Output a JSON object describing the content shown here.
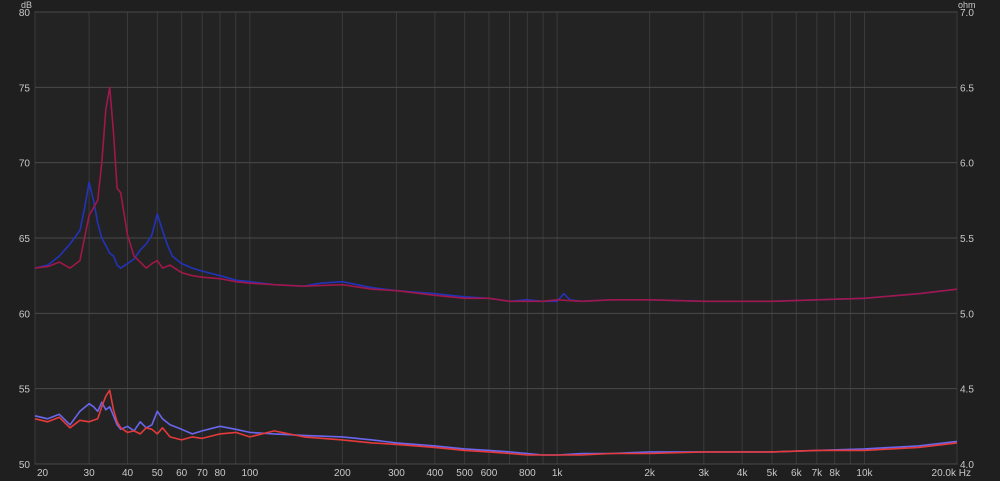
{
  "chart_data": {
    "type": "line",
    "x_scale": "log",
    "x_unit": "Hz",
    "y_left_unit": "dB",
    "y_right_unit": "ohm",
    "xlim": [
      20,
      20000
    ],
    "ylim_left": [
      50,
      80
    ],
    "ylim_right": [
      4.0,
      7.0
    ],
    "grid": true,
    "x_ticks": [
      {
        "v": 20,
        "label": "20"
      },
      {
        "v": 30,
        "label": "30"
      },
      {
        "v": 40,
        "label": "40"
      },
      {
        "v": 50,
        "label": "50"
      },
      {
        "v": 60,
        "label": "60"
      },
      {
        "v": 70,
        "label": "70"
      },
      {
        "v": 80,
        "label": "80"
      },
      {
        "v": 100,
        "label": "100"
      },
      {
        "v": 200,
        "label": "200"
      },
      {
        "v": 300,
        "label": "300"
      },
      {
        "v": 400,
        "label": "400"
      },
      {
        "v": 500,
        "label": "500"
      },
      {
        "v": 600,
        "label": "600"
      },
      {
        "v": 800,
        "label": "800"
      },
      {
        "v": 1000,
        "label": "1k"
      },
      {
        "v": 2000,
        "label": "2k"
      },
      {
        "v": 3000,
        "label": "3k"
      },
      {
        "v": 4000,
        "label": "4k"
      },
      {
        "v": 5000,
        "label": "5k"
      },
      {
        "v": 6000,
        "label": "6k"
      },
      {
        "v": 7000,
        "label": "7k"
      },
      {
        "v": 8000,
        "label": "8k"
      },
      {
        "v": 10000,
        "label": "10k"
      },
      {
        "v": 20000,
        "label": "20.0k Hz"
      }
    ],
    "y_left_ticks": [
      "80",
      "75",
      "70",
      "65",
      "60",
      "55",
      "50"
    ],
    "y_right_ticks": [
      "7.0",
      "6.5",
      "6.0",
      "5.5",
      "5.0",
      "4.5",
      "4.0"
    ],
    "series": [
      {
        "color": "#2233bb",
        "axis": "left",
        "x": [
          20,
          22,
          24,
          26,
          28,
          29,
          30,
          31,
          32,
          33,
          34,
          35,
          36,
          37,
          38,
          40,
          42,
          44,
          46,
          48,
          50,
          52,
          54,
          56,
          60,
          65,
          70,
          80,
          90,
          100,
          120,
          150,
          170,
          200,
          250,
          300,
          400,
          500,
          600,
          700,
          800,
          900,
          1000,
          1050,
          1100,
          1200,
          1500,
          2000,
          3000,
          5000,
          7000,
          10000,
          15000,
          20000
        ],
        "y": [
          63.0,
          63.2,
          63.8,
          64.6,
          65.5,
          67.0,
          68.7,
          67.5,
          66.0,
          65.0,
          64.5,
          64.0,
          63.8,
          63.2,
          63.0,
          63.3,
          63.6,
          64.2,
          64.6,
          65.2,
          66.6,
          65.5,
          64.5,
          63.8,
          63.3,
          63.0,
          62.8,
          62.5,
          62.2,
          62.1,
          61.9,
          61.8,
          62.0,
          62.1,
          61.7,
          61.5,
          61.3,
          61.1,
          61.0,
          60.8,
          60.9,
          60.8,
          60.8,
          61.3,
          60.9,
          60.8,
          60.9,
          60.9,
          60.8,
          60.8,
          60.9,
          61.0,
          61.3,
          61.6
        ]
      },
      {
        "color": "#a0184a",
        "axis": "left",
        "x": [
          20,
          22,
          24,
          26,
          28,
          30,
          32,
          33,
          34,
          35,
          36,
          37,
          38,
          40,
          42,
          44,
          46,
          48,
          50,
          52,
          55,
          60,
          65,
          70,
          80,
          90,
          100,
          120,
          150,
          200,
          250,
          300,
          400,
          500,
          600,
          700,
          800,
          900,
          1000,
          1200,
          1500,
          2000,
          3000,
          5000,
          7000,
          10000,
          15000,
          20000
        ],
        "y": [
          63.0,
          63.1,
          63.4,
          63.0,
          63.5,
          66.5,
          67.5,
          70.0,
          73.5,
          75.0,
          72.0,
          68.3,
          68.0,
          65.2,
          63.8,
          63.4,
          63.0,
          63.3,
          63.5,
          63.0,
          63.2,
          62.7,
          62.5,
          62.4,
          62.3,
          62.1,
          62.0,
          61.9,
          61.8,
          61.9,
          61.6,
          61.5,
          61.2,
          61.0,
          61.0,
          60.8,
          60.8,
          60.8,
          60.9,
          60.8,
          60.9,
          60.9,
          60.8,
          60.8,
          60.9,
          61.0,
          61.3,
          61.6
        ]
      },
      {
        "color": "#6a66ee",
        "axis": "left",
        "x": [
          20,
          22,
          24,
          26,
          28,
          30,
          31,
          32,
          33,
          34,
          35,
          36,
          37,
          38,
          40,
          42,
          44,
          46,
          48,
          50,
          52,
          55,
          60,
          65,
          70,
          80,
          90,
          100,
          120,
          150,
          200,
          250,
          300,
          400,
          500,
          600,
          700,
          800,
          900,
          1000,
          1200,
          1500,
          2000,
          3000,
          5000,
          7000,
          10000,
          15000,
          20000
        ],
        "y": [
          53.2,
          53.0,
          53.3,
          52.6,
          53.5,
          54.0,
          53.8,
          53.5,
          54.1,
          53.6,
          53.8,
          53.2,
          52.6,
          52.3,
          52.5,
          52.2,
          52.8,
          52.4,
          52.6,
          53.5,
          53.0,
          52.6,
          52.3,
          52.0,
          52.2,
          52.5,
          52.3,
          52.1,
          52.0,
          51.9,
          51.8,
          51.6,
          51.4,
          51.2,
          51.0,
          50.9,
          50.8,
          50.7,
          50.6,
          50.6,
          50.7,
          50.7,
          50.8,
          50.8,
          50.8,
          50.9,
          51.0,
          51.2,
          51.5
        ]
      },
      {
        "color": "#e43a3a",
        "axis": "left",
        "x": [
          20,
          22,
          24,
          26,
          28,
          30,
          32,
          33,
          34,
          35,
          36,
          37,
          38,
          40,
          42,
          44,
          46,
          48,
          50,
          52,
          55,
          60,
          65,
          70,
          80,
          90,
          100,
          120,
          150,
          200,
          250,
          300,
          400,
          500,
          600,
          700,
          800,
          900,
          1000,
          1200,
          1500,
          2000,
          3000,
          5000,
          7000,
          10000,
          15000,
          20000
        ],
        "y": [
          53.0,
          52.8,
          53.1,
          52.4,
          52.9,
          52.8,
          53.0,
          53.8,
          54.5,
          54.9,
          53.6,
          52.8,
          52.4,
          52.1,
          52.2,
          52.0,
          52.4,
          52.3,
          52.0,
          52.4,
          51.8,
          51.6,
          51.8,
          51.7,
          52.0,
          52.1,
          51.8,
          52.2,
          51.8,
          51.6,
          51.4,
          51.3,
          51.1,
          50.9,
          50.8,
          50.7,
          50.6,
          50.6,
          50.6,
          50.6,
          50.7,
          50.7,
          50.8,
          50.8,
          50.9,
          50.9,
          51.1,
          51.4
        ]
      }
    ]
  }
}
